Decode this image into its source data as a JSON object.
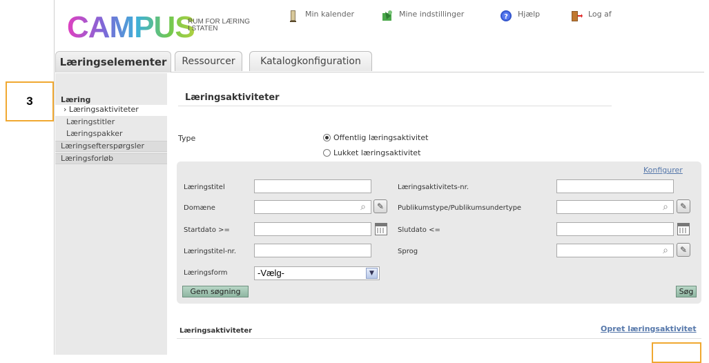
{
  "annotation": {
    "number": "3"
  },
  "header": {
    "logo": "CAMPUS",
    "tagline_line1": "RUM FOR LÆRING",
    "tagline_line2": "I STATEN",
    "links": [
      {
        "label": "Min kalender",
        "icon": "calendar-icon"
      },
      {
        "label": "Mine indstillinger",
        "icon": "settings-icon"
      },
      {
        "label": "Hjælp",
        "icon": "help-icon"
      },
      {
        "label": "Log af",
        "icon": "logout-icon"
      }
    ]
  },
  "tabs": [
    {
      "label": "Læringselementer",
      "active": true
    },
    {
      "label": "Ressourcer"
    },
    {
      "label": "Katalogkonfiguration"
    }
  ],
  "sidebar": {
    "section": "Læring",
    "items": [
      {
        "label": "› Læringsaktiviteter",
        "active": true
      },
      {
        "label": "Læringstitler"
      },
      {
        "label": "Læringspakker"
      },
      {
        "label": "Læringsefterspørgsler"
      },
      {
        "label": "Læringsforløb"
      }
    ]
  },
  "main": {
    "title": "Læringsaktiviteter",
    "type": {
      "label": "Type",
      "options": [
        {
          "label": "Offentlig læringsaktivitet",
          "selected": true
        },
        {
          "label": "Lukket læringsaktivitet",
          "selected": false
        }
      ]
    },
    "search": {
      "configure_link": "Konfigurer",
      "fields": {
        "learning_title": "Læringstitel",
        "activity_number": "Læringsaktivitets-nr.",
        "domain": "Domæne",
        "audience_type": "Publikumstype/Publikumsundertype",
        "start_date": "Startdato >=",
        "end_date": "Slutdato <=",
        "title_number": "Læringstitel-nr.",
        "language": "Sprog",
        "learning_form": "Læringsform"
      },
      "learning_form_value": "-Vælg-",
      "save_search_button": "Gem søgning",
      "search_button": "Søg"
    },
    "results": {
      "title": "Læringsaktiviteter",
      "create_link": "Opret læringsaktivitet"
    }
  }
}
